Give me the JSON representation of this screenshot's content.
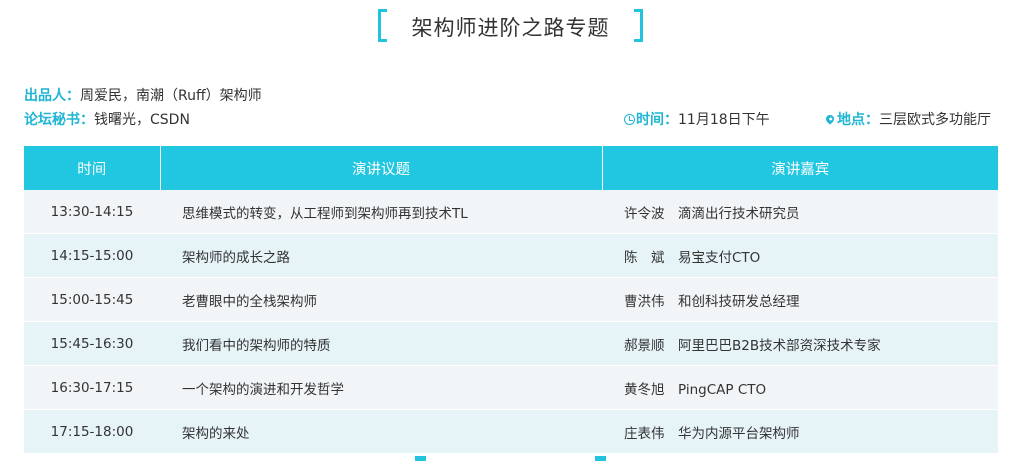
{
  "title": "架构师进阶之路专题",
  "producer": {
    "label": "出品人：",
    "value": "周爱民，南潮（Ruff）架构师"
  },
  "secretary": {
    "label": "论坛秘书：",
    "value": "钱曙光，CSDN"
  },
  "time_info": {
    "label": "时间：",
    "value": "11月18日下午",
    "icon": "clock-icon"
  },
  "place_info": {
    "label": "地点：",
    "value": "三层欧式多功能厅",
    "icon": "map-pin-icon"
  },
  "accent_color": "#21c6e0",
  "table": {
    "headers": {
      "time": "时间",
      "topic": "演讲议题",
      "speaker": "演讲嘉宾"
    },
    "rows": [
      {
        "time": "13:30-14:15",
        "topic": "思维模式的转变，从工程师到架构师再到技术TL",
        "name": "许令波",
        "title": "滴滴出行技术研究员"
      },
      {
        "time": "14:15-15:00",
        "topic": "架构师的成长之路",
        "name": "陈　斌",
        "title": "易宝支付CTO"
      },
      {
        "time": "15:00-15:45",
        "topic": "老曹眼中的全栈架构师",
        "name": "曹洪伟",
        "title": "和创科技研发总经理"
      },
      {
        "time": "15:45-16:30",
        "topic": "我们看中的架构师的特质",
        "name": "郝景顺",
        "title": "阿里巴巴B2B技术部资深技术专家"
      },
      {
        "time": "16:30-17:15",
        "topic": "一个架构的演进和开发哲学",
        "name": "黄冬旭",
        "title": "PingCAP CTO"
      },
      {
        "time": "17:15-18:00",
        "topic": "架构的来处",
        "name": "庄表伟",
        "title": "华为内源平台架构师"
      }
    ]
  }
}
